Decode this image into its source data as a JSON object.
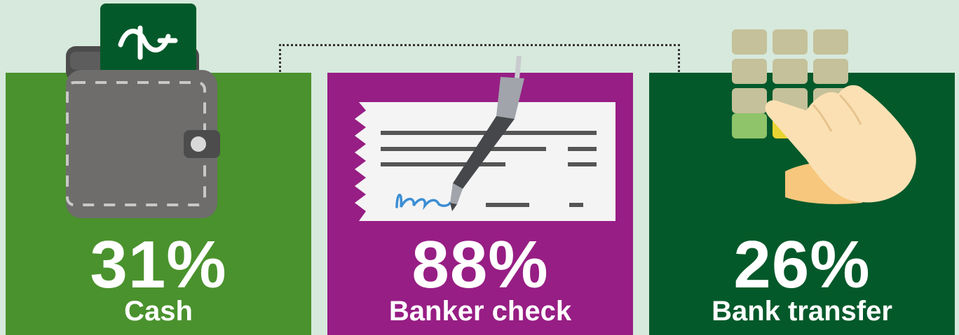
{
  "colors": {
    "background": "#d6e9dc",
    "cash_panel": "#4a922d",
    "check_panel": "#971e84",
    "transfer_panel": "#03592a"
  },
  "stats": [
    {
      "percent": "31%",
      "label": "Cash",
      "icon": "wallet-icon"
    },
    {
      "percent": "88%",
      "label": "Banker check",
      "icon": "check-pen-icon"
    },
    {
      "percent": "26%",
      "label": "Bank transfer",
      "icon": "keypad-hand-icon"
    }
  ]
}
